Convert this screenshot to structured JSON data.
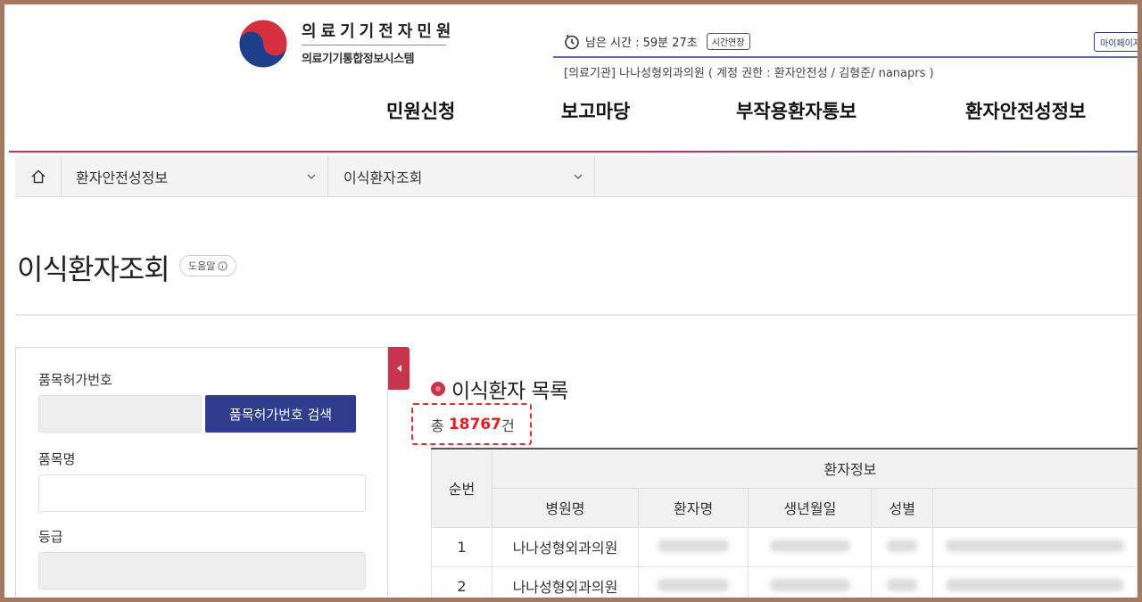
{
  "header": {
    "logo_title": "의료기기전자민원",
    "logo_subtitle": "의료기기통합정보시스템",
    "timer_text": "남은 시간 : 59분 27초",
    "extend_label": "시간연장",
    "mypage_label": "마이페이지",
    "user_info": "[의료기관] 나나성형외과의원 ( 계정 권한 : 환자안전성 / 김형준/ nanaprs )"
  },
  "gnb": {
    "items": [
      "민원신청",
      "보고마당",
      "부작용환자통보",
      "환자안전성정보"
    ]
  },
  "breadcrumb": {
    "level1": "환자안전성정보",
    "level2": "이식환자조회"
  },
  "page": {
    "title": "이식환자조회",
    "help_label": "도움말"
  },
  "search": {
    "permit_no_label": "품목허가번호",
    "permit_search_button": "품목허가번호 검색",
    "product_name_label": "품목명",
    "grade_label": "등급"
  },
  "list": {
    "title": "이식환자 목록",
    "total_prefix": "총 ",
    "total_count": "18767",
    "total_suffix": "건",
    "columns": {
      "no": "순번",
      "patient_group": "환자정보",
      "hospital": "병원명",
      "patient_name": "환자명",
      "birth": "생년월일",
      "gender": "성별"
    },
    "rows": [
      {
        "no": "1",
        "hospital": "나나성형외과의원"
      },
      {
        "no": "2",
        "hospital": "나나성형외과의원"
      }
    ]
  },
  "colors": {
    "brand_red": "#c8334d",
    "brand_navy": "#303d8c",
    "frame": "#a57a63",
    "highlight": "#e02020"
  }
}
